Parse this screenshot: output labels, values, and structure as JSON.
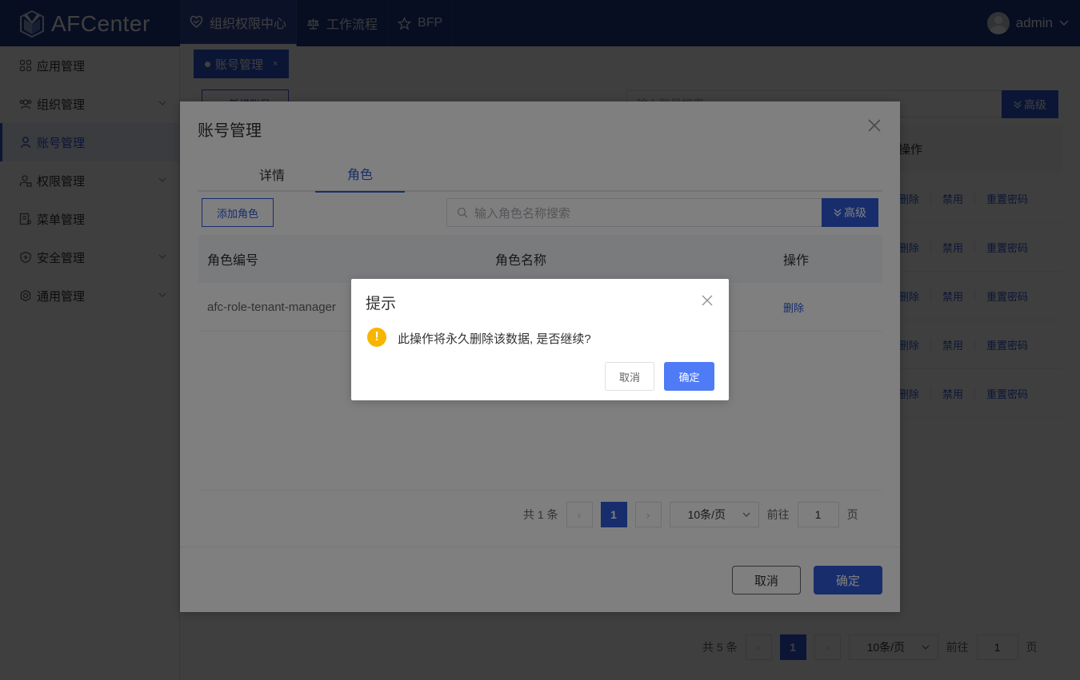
{
  "app": {
    "title": "AFCenter",
    "user": "admin"
  },
  "topnav": [
    {
      "label": "组织权限中心",
      "icon": "heart-shield-icon",
      "active": true
    },
    {
      "label": "工作流程",
      "icon": "scale-icon",
      "active": false
    },
    {
      "label": "BFP",
      "icon": "star-icon",
      "active": false
    }
  ],
  "sidebar": {
    "items": [
      {
        "label": "应用管理",
        "icon": "grid-icon",
        "expandable": false,
        "active": false
      },
      {
        "label": "组织管理",
        "icon": "team-icon",
        "expandable": true,
        "active": false
      },
      {
        "label": "账号管理",
        "icon": "user-icon",
        "expandable": false,
        "active": true
      },
      {
        "label": "权限管理",
        "icon": "permission-icon",
        "expandable": true,
        "active": false
      },
      {
        "label": "菜单管理",
        "icon": "menu-icon",
        "expandable": false,
        "active": false
      },
      {
        "label": "安全管理",
        "icon": "shield-plus-icon",
        "expandable": true,
        "active": false
      },
      {
        "label": "通用管理",
        "icon": "gear-icon",
        "expandable": true,
        "active": false
      }
    ]
  },
  "page_tab": {
    "label": "账号管理",
    "close": "×"
  },
  "background": {
    "new_button": "+ 新增账号",
    "search_placeholder": "输入账号搜索",
    "advanced": "高级",
    "ops_header": "操作",
    "row_actions": [
      "删除",
      "禁用",
      "重置密码"
    ],
    "row_count": 5,
    "pager": {
      "total": "共 5 条",
      "current": "1",
      "size": "10条/页",
      "goto": "前往",
      "page_input": "1",
      "page_unit": "页"
    }
  },
  "dialog": {
    "title": "账号管理",
    "tabs": [
      {
        "label": "详情",
        "active": false
      },
      {
        "label": "角色",
        "active": true
      }
    ],
    "add_role": "添加角色",
    "search_placeholder": "输入角色名称搜索",
    "advanced": "高级",
    "columns": [
      "角色编号",
      "角色名称",
      "操作"
    ],
    "rows": [
      {
        "code": "afc-role-tenant-manager",
        "name": "",
        "action": "删除"
      }
    ],
    "pager": {
      "total": "共 1 条",
      "current": "1",
      "size": "10条/页",
      "goto": "前往",
      "page_input": "1",
      "page_unit": "页"
    },
    "cancel": "取消",
    "ok": "确定"
  },
  "confirm": {
    "title": "提示",
    "icon": "!",
    "message": "此操作将永久删除该数据, 是否继续?",
    "cancel": "取消",
    "ok": "确定"
  },
  "colors": {
    "header": "#1e3a8a",
    "primary": "#2f5bd8",
    "warning": "#f7b500"
  }
}
